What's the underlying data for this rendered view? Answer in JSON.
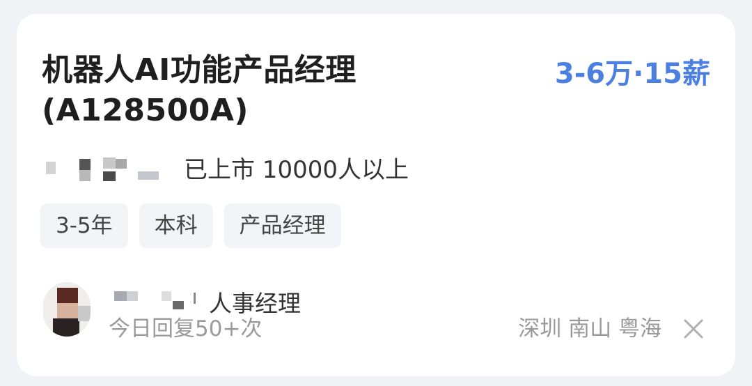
{
  "job": {
    "title": "机器人AI功能产品经理(A128500A)",
    "salary": "3-6万·15薪"
  },
  "company": {
    "info": "已上市 10000人以上"
  },
  "tags": [
    "3-5年",
    "本科",
    "产品经理"
  ],
  "recruiter": {
    "role": "人事经理",
    "reply_info": "今日回复50+次"
  },
  "location": "深圳 南山 粤海",
  "icons": {
    "close": "close-icon",
    "avatar": "avatar"
  },
  "colors": {
    "salary": "#4b7fe0",
    "background": "#f1f2f5",
    "tag_background": "#f3f4f7"
  }
}
